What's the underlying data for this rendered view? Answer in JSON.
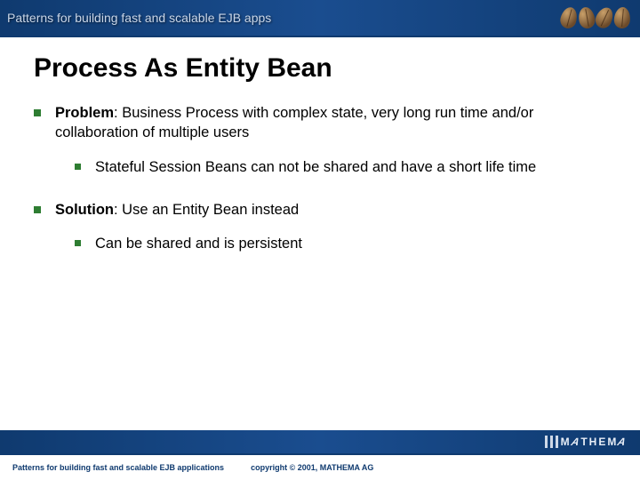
{
  "header": {
    "title": "Patterns for building fast and scalable EJB apps"
  },
  "slide": {
    "title": "Process As Entity Bean",
    "bullet1_label": "Problem",
    "bullet1_text": ": Business Process with complex state, very long run time and/or collaboration of multiple users",
    "bullet1_sub": "Stateful Session Beans can not be shared and have a short life time",
    "bullet2_label": "Solution",
    "bullet2_text": ": Use an Entity Bean instead",
    "bullet2_sub": "Can be shared and is persistent"
  },
  "footer": {
    "left": "Patterns for building fast and scalable EJB applications",
    "right": "copyright © 2001, MATHEMA AG",
    "logo": "MATHEMA"
  }
}
